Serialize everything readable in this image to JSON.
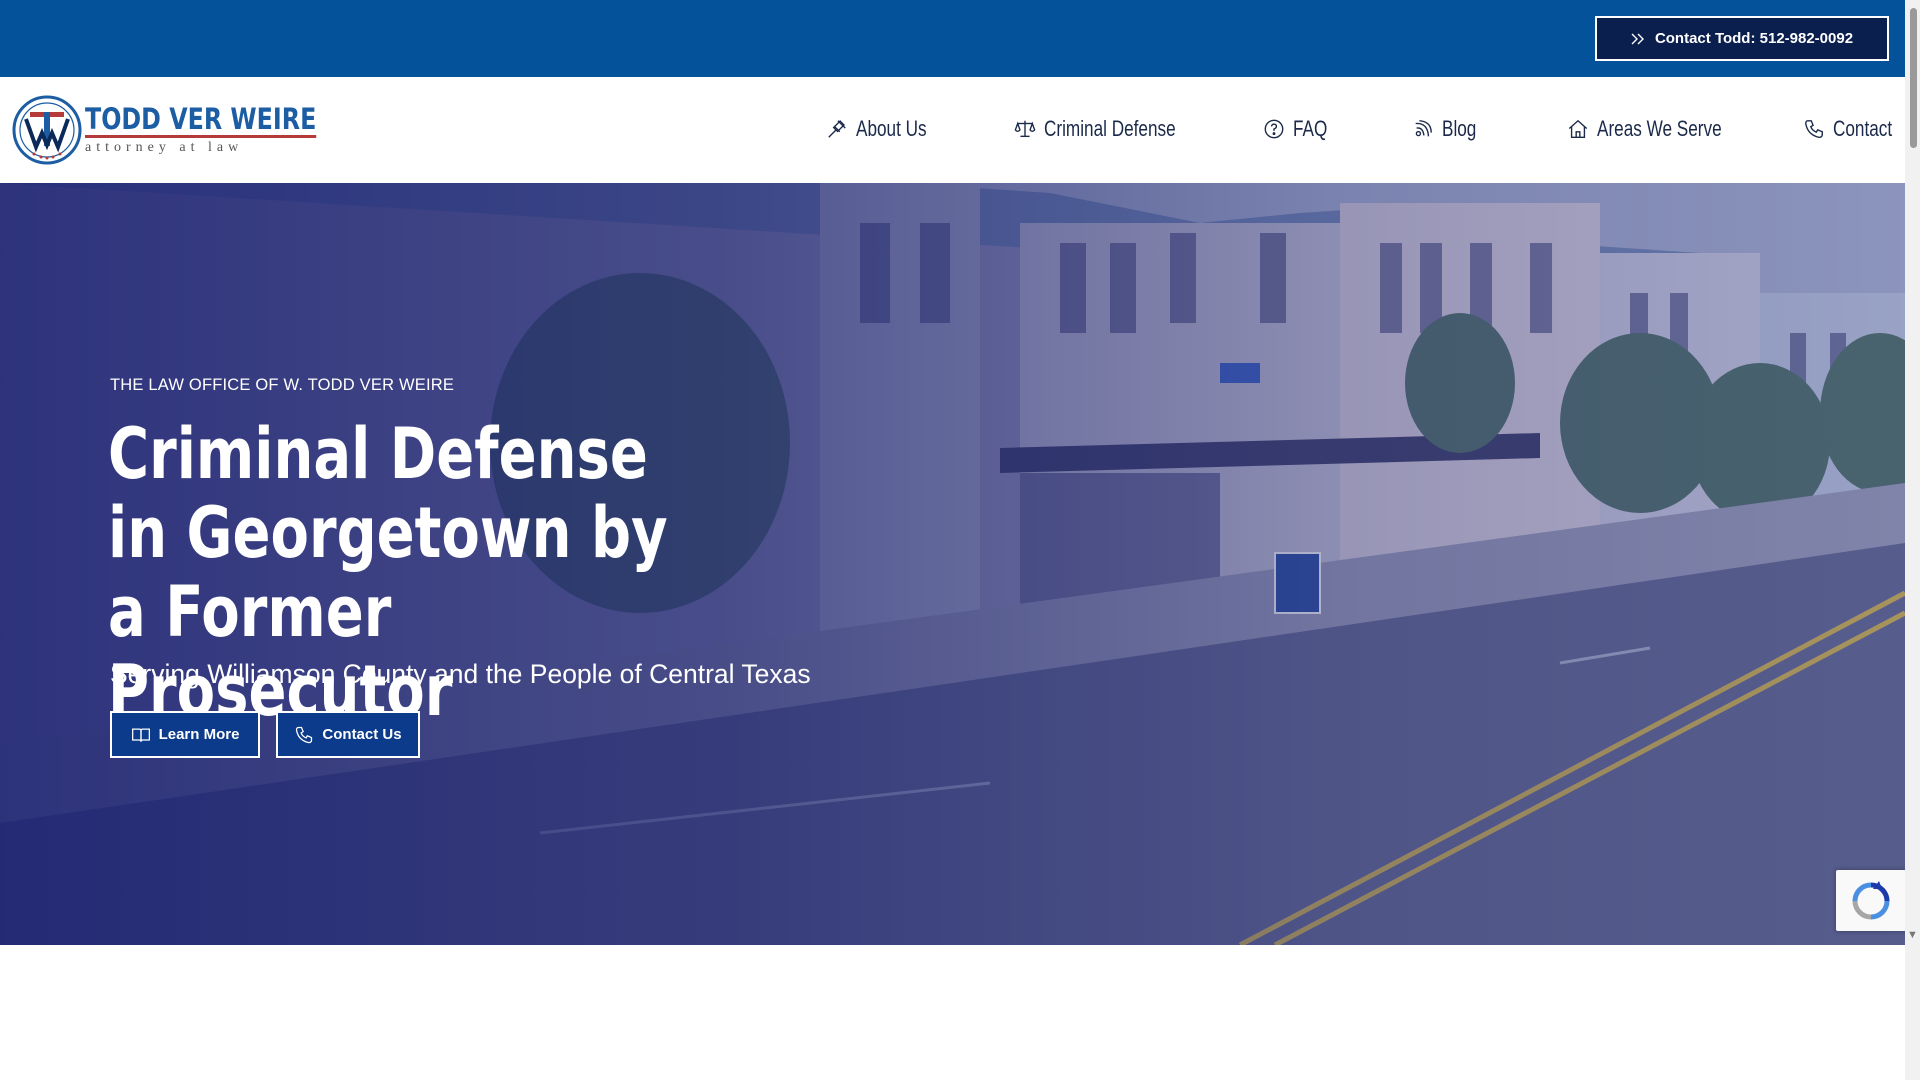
{
  "topbar": {
    "contact_button": "Contact Todd: 512-982-0092",
    "contact_icon": "double-chevron-right-icon",
    "background_color": "#03529a",
    "button_color": "#0b1f4f"
  },
  "header": {
    "logo": {
      "name": "TODD VER WEIRE",
      "tagline": "attorney at law",
      "monogram": "TVW"
    },
    "nav": [
      {
        "label": "About Us",
        "icon": "gavel-icon"
      },
      {
        "label": "Criminal Defense",
        "icon": "scales-icon"
      },
      {
        "label": "FAQ",
        "icon": "question-circle-icon"
      },
      {
        "label": "Blog",
        "icon": "broadcast-icon"
      },
      {
        "label": "Areas We Serve",
        "icon": "home-icon"
      },
      {
        "label": "Contact",
        "icon": "phone-icon"
      }
    ]
  },
  "hero": {
    "eyebrow": "THE LAW OFFICE OF W. TODD VER WEIRE",
    "headline": "Criminal Defense in Georgetown by a Former Prosecutor",
    "subheadline": "Serving Williamson County and the People of Central Texas",
    "buttons": {
      "learn_more": "Learn More",
      "learn_more_icon": "book-icon",
      "contact_us": "Contact Us",
      "contact_us_icon": "phone-icon"
    },
    "overlay_color": "#1e246e"
  },
  "recaptcha": {
    "icon": "recaptcha-icon"
  }
}
